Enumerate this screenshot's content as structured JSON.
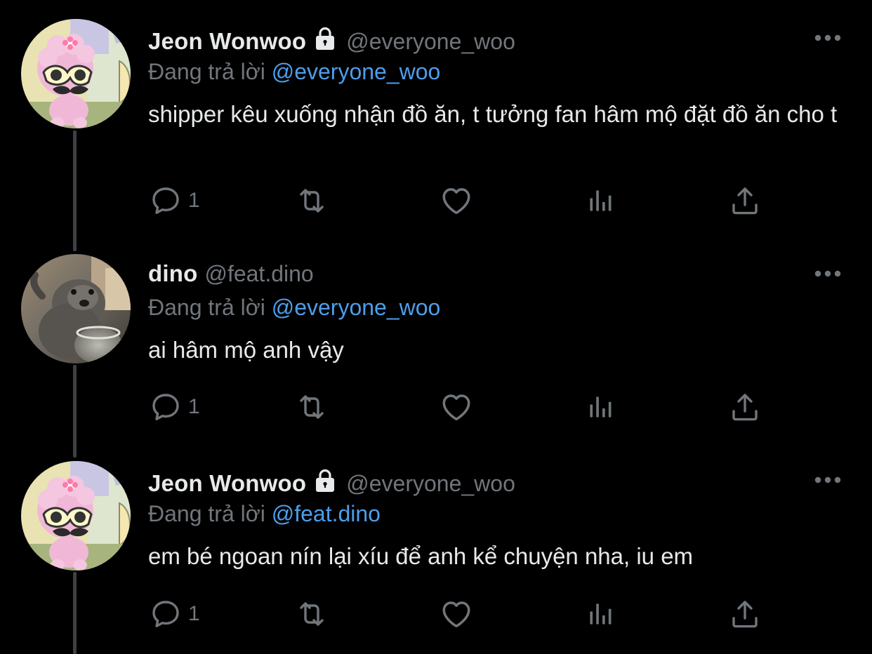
{
  "colors": {
    "background": "#000000",
    "text": "#e7e9ea",
    "secondary": "#71767b",
    "link": "#4c9eeb",
    "thread_line": "#3e4144"
  },
  "tweets": [
    {
      "name": "Jeon Wonwoo",
      "protected": true,
      "handle": "@everyone_woo",
      "replying_label": "Đang trả lời",
      "replying_to": "@everyone_woo",
      "text": "shipper kêu xuống nhận đồ ăn, t tưởng fan hâm mộ đặt đồ ăn cho t",
      "reply_count": "1",
      "avatar": "pink-sheep-cartoon-with-sunglasses-and-mustache"
    },
    {
      "name": "dino",
      "protected": false,
      "handle": "@feat.dino",
      "replying_label": "Đang trả lời",
      "replying_to": "@everyone_woo",
      "text": "ai hâm mộ anh vậy",
      "reply_count": "1",
      "avatar": "otter-photo"
    },
    {
      "name": "Jeon Wonwoo",
      "protected": true,
      "handle": "@everyone_woo",
      "replying_label": "Đang trả lời",
      "replying_to": "@feat.dino",
      "text": "em bé ngoan nín lại xíu để anh kể chuyện nha, iu em",
      "reply_count": "1",
      "avatar": "pink-sheep-cartoon-with-sunglasses-and-mustache"
    }
  ],
  "icons": {
    "reply": "speech-bubble-icon",
    "retweet": "retweet-icon",
    "like": "heart-icon",
    "analytics": "bar-chart-icon",
    "share": "share-upload-icon",
    "more": "ellipsis-icon",
    "protected": "lock-icon"
  }
}
